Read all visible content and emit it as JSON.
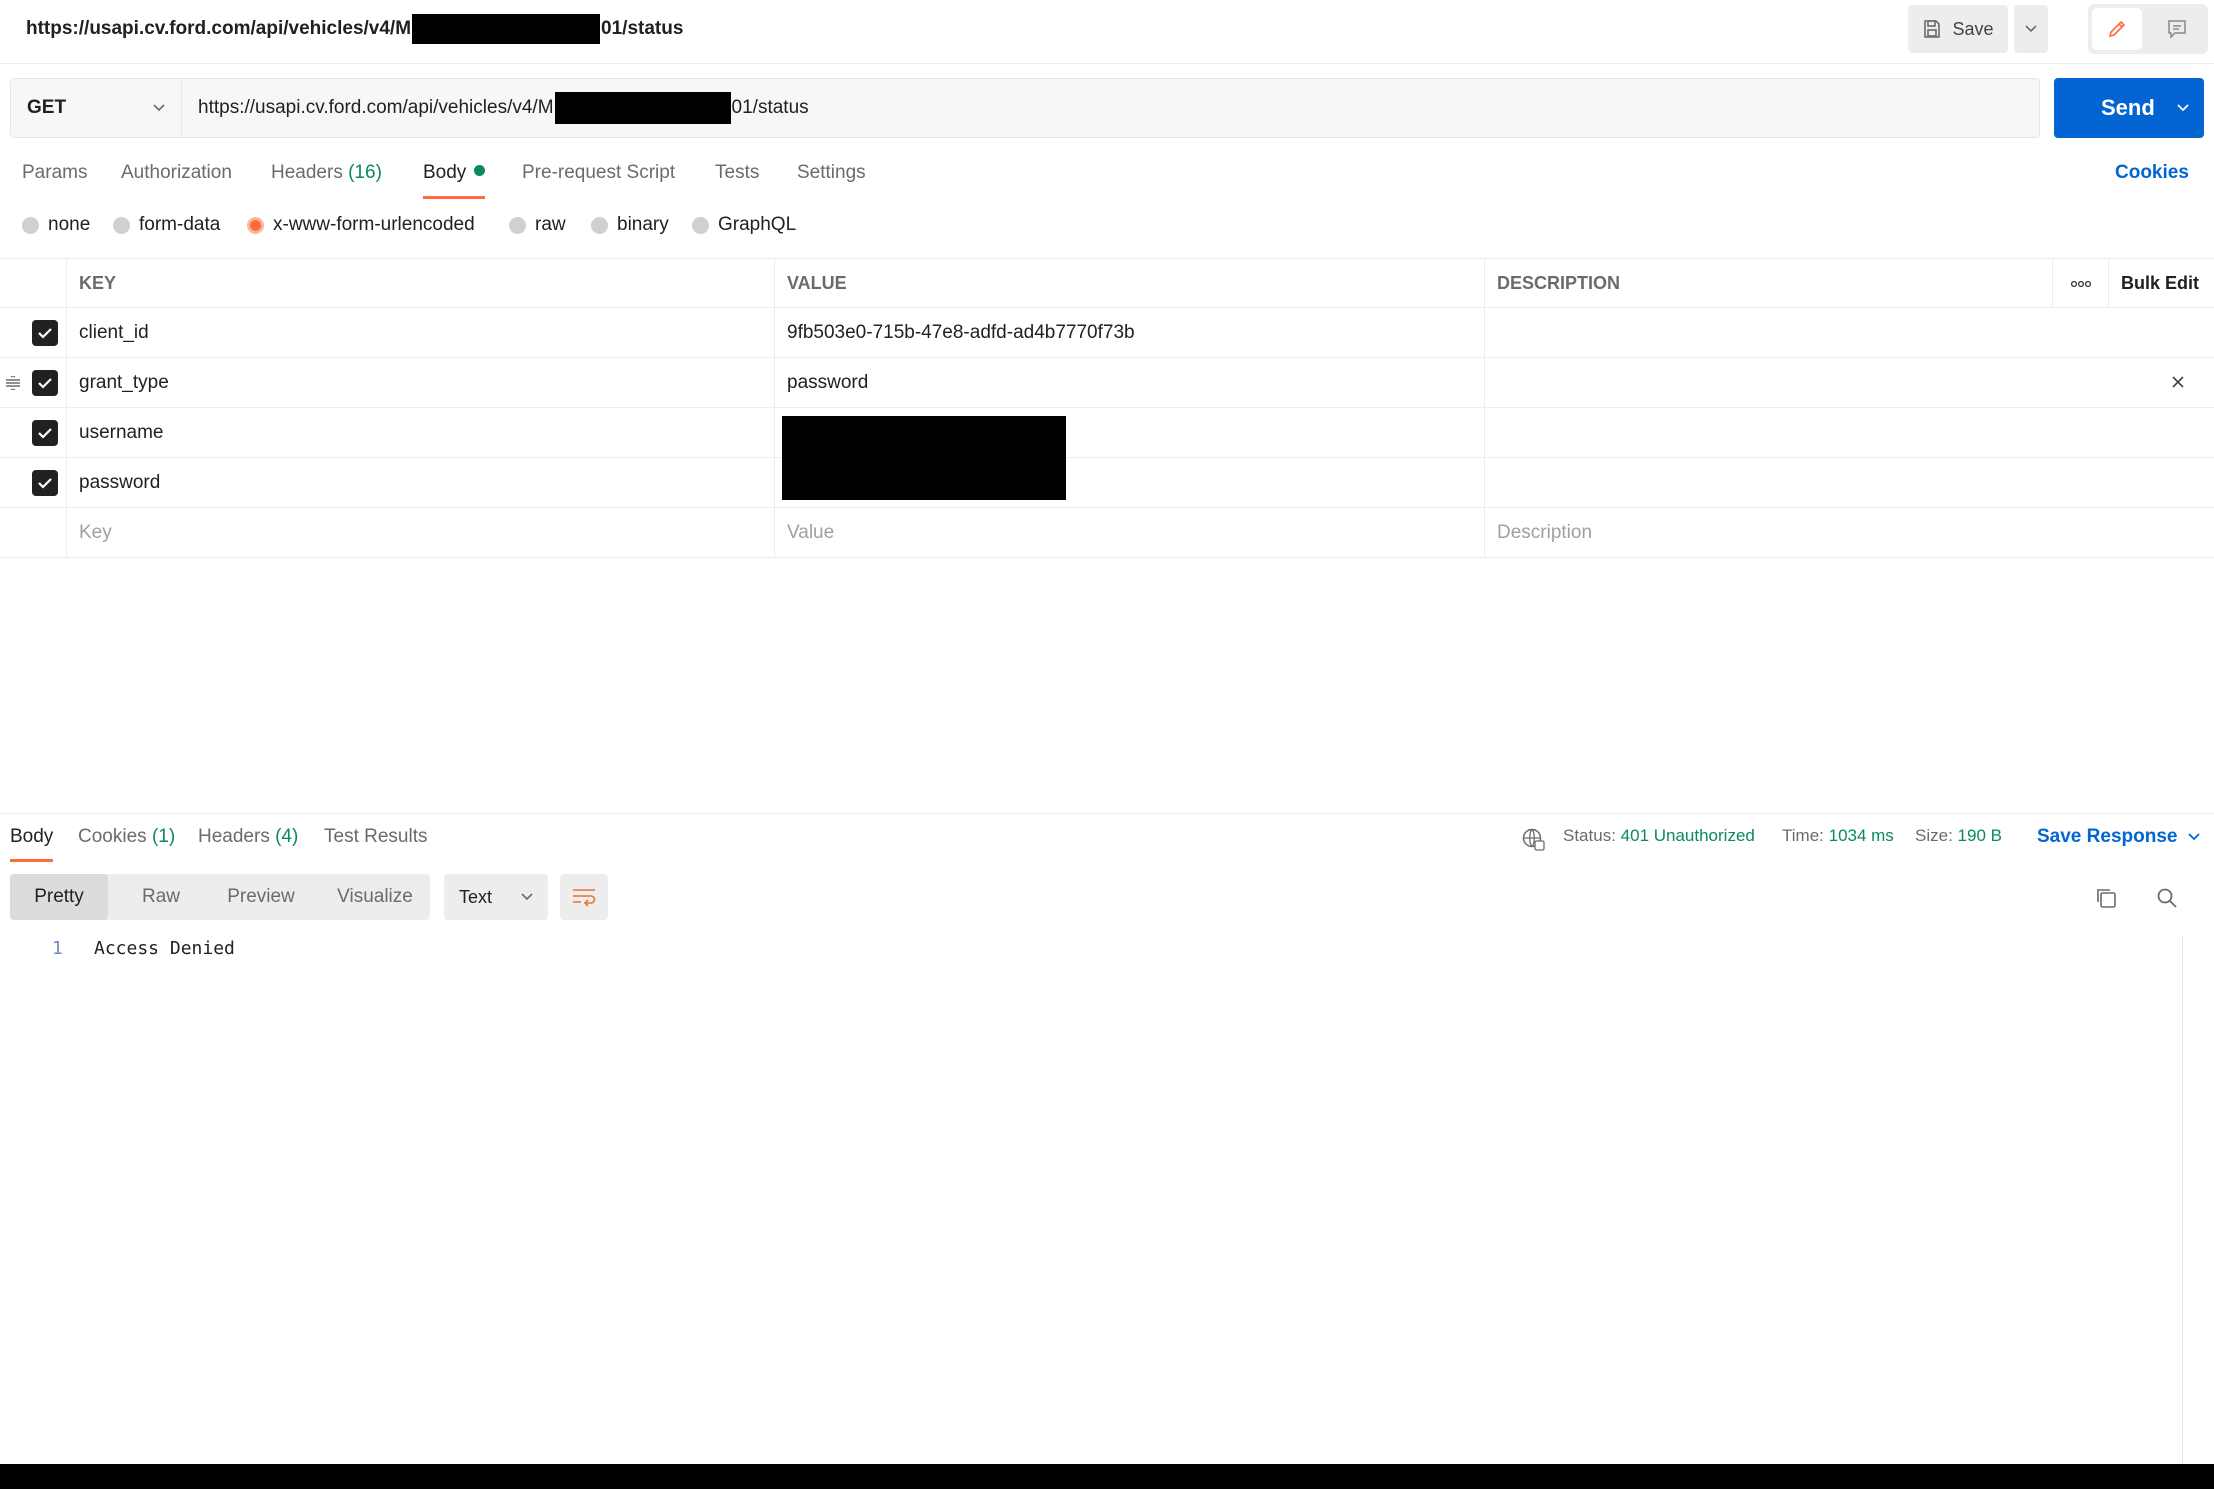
{
  "title_bar": {
    "url_prefix": "https://usapi.cv.ford.com/api/vehicles/v4/M",
    "url_suffix": "01/status",
    "save_label": "Save",
    "icons": [
      "save-icon",
      "chevron-down-icon",
      "pencil-icon",
      "comment-icon"
    ]
  },
  "request": {
    "method": "GET",
    "url_prefix": "https://usapi.cv.ford.com/api/vehicles/v4/M",
    "url_suffix": "01/status",
    "send_label": "Send"
  },
  "request_tabs": {
    "params": "Params",
    "authorization": "Authorization",
    "headers": "Headers",
    "headers_count": "(16)",
    "body": "Body",
    "pre_request": "Pre-request Script",
    "tests": "Tests",
    "settings": "Settings",
    "cookies": "Cookies"
  },
  "body_types": {
    "none": "none",
    "form_data": "form-data",
    "urlencoded": "x-www-form-urlencoded",
    "raw": "raw",
    "binary": "binary",
    "graphql": "GraphQL",
    "selected": "x-www-form-urlencoded"
  },
  "params_table": {
    "headers": {
      "key": "KEY",
      "value": "VALUE",
      "description": "DESCRIPTION",
      "bulk_edit": "Bulk Edit"
    },
    "rows": [
      {
        "key": "client_id",
        "value": "9fb503e0-715b-47e8-adfd-ad4b7770f73b",
        "description": ""
      },
      {
        "key": "grant_type",
        "value": "password",
        "description": ""
      },
      {
        "key": "username",
        "value": "",
        "description": ""
      },
      {
        "key": "password",
        "value": "",
        "description": ""
      }
    ],
    "placeholder": {
      "key": "Key",
      "value": "Value",
      "description": "Description"
    }
  },
  "response": {
    "tabs": {
      "body": "Body",
      "cookies": "Cookies",
      "cookies_count": "(1)",
      "headers": "Headers",
      "headers_count": "(4)",
      "test_results": "Test Results"
    },
    "status_label": "Status:",
    "status_value": "401 Unauthorized",
    "time_label": "Time:",
    "time_value": "1034 ms",
    "size_label": "Size:",
    "size_value": "190 B",
    "save_response": "Save Response",
    "views": {
      "pretty": "Pretty",
      "raw": "Raw",
      "preview": "Preview",
      "visualize": "Visualize"
    },
    "format": "Text",
    "line_number": "1",
    "body_text": "Access Denied"
  },
  "colors": {
    "accent_orange": "#ff6c37",
    "send_blue": "#0265d2",
    "status_green": "#0a8a57"
  }
}
